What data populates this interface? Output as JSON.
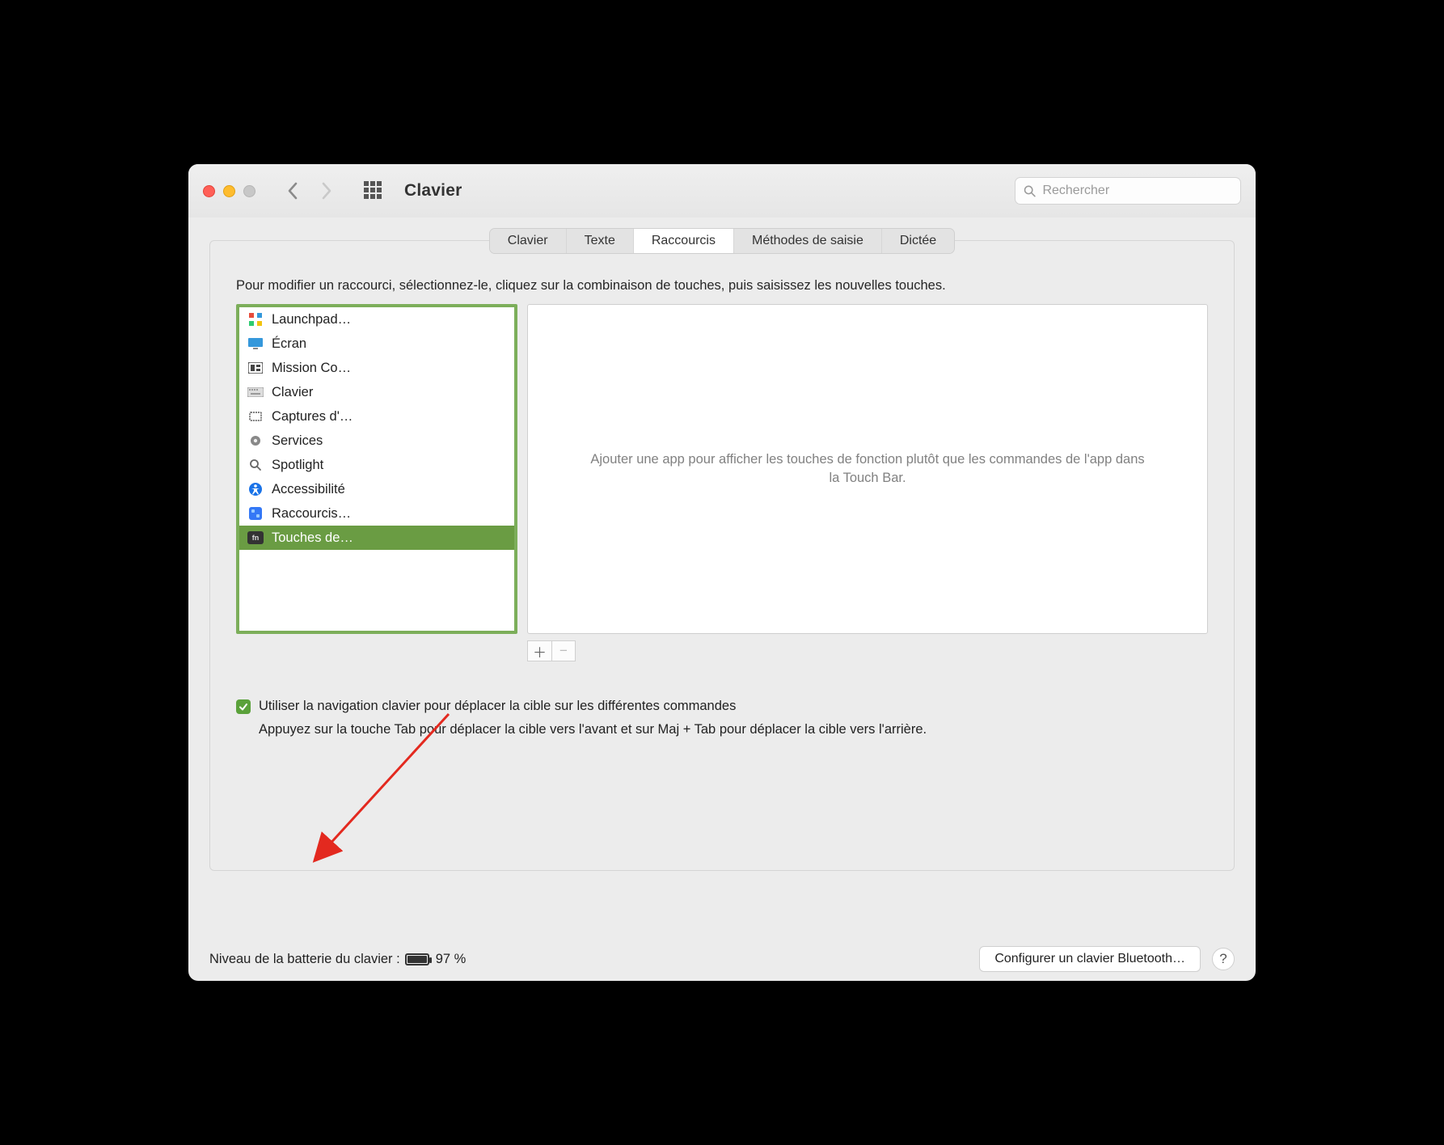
{
  "window": {
    "title": "Clavier"
  },
  "search": {
    "placeholder": "Rechercher"
  },
  "tabs": {
    "items": [
      {
        "label": "Clavier"
      },
      {
        "label": "Texte"
      },
      {
        "label": "Raccourcis"
      },
      {
        "label": "Méthodes de saisie"
      },
      {
        "label": "Dictée"
      }
    ],
    "activeIndex": 2
  },
  "instruction": "Pour modifier un raccourci, sélectionnez-le, cliquez sur la combinaison de touches, puis saisissez les nouvelles touches.",
  "sidebar": {
    "items": [
      {
        "label": "Launchpad…",
        "icon": "launchpad-icon"
      },
      {
        "label": "Écran",
        "icon": "display-icon"
      },
      {
        "label": "Mission Co…",
        "icon": "mission-control-icon"
      },
      {
        "label": "Clavier",
        "icon": "keyboard-icon"
      },
      {
        "label": "Captures d'…",
        "icon": "screenshot-icon"
      },
      {
        "label": "Services",
        "icon": "gear-icon"
      },
      {
        "label": "Spotlight",
        "icon": "search-icon"
      },
      {
        "label": "Accessibilité",
        "icon": "accessibility-icon"
      },
      {
        "label": "Raccourcis…",
        "icon": "shortcuts-icon"
      },
      {
        "label": "Touches de…",
        "icon": "fn-icon"
      }
    ],
    "selectedIndex": 9
  },
  "rightPane": {
    "emptyText": "Ajouter une app pour afficher les touches de fonction plutôt que les commandes de l'app dans la Touch Bar."
  },
  "checkbox": {
    "checked": true,
    "label": "Utiliser la navigation clavier pour déplacer la cible sur les différentes commandes",
    "help": "Appuyez sur la touche Tab pour déplacer la cible vers l'avant et sur Maj + Tab pour déplacer la cible vers l'arrière."
  },
  "footer": {
    "batteryLabel": "Niveau de la batterie du clavier :",
    "batteryPercent": "97 %",
    "bluetoothButton": "Configurer un clavier Bluetooth…"
  },
  "icons": {
    "launchpad": "⊞",
    "display": "🖥",
    "mission": "▭",
    "keyboard": "⌨",
    "screenshot": "⧉",
    "gear": "⚙",
    "spotlight": "🔍",
    "accessibility": "❖",
    "shortcuts": "⌘",
    "fn": "fn"
  }
}
